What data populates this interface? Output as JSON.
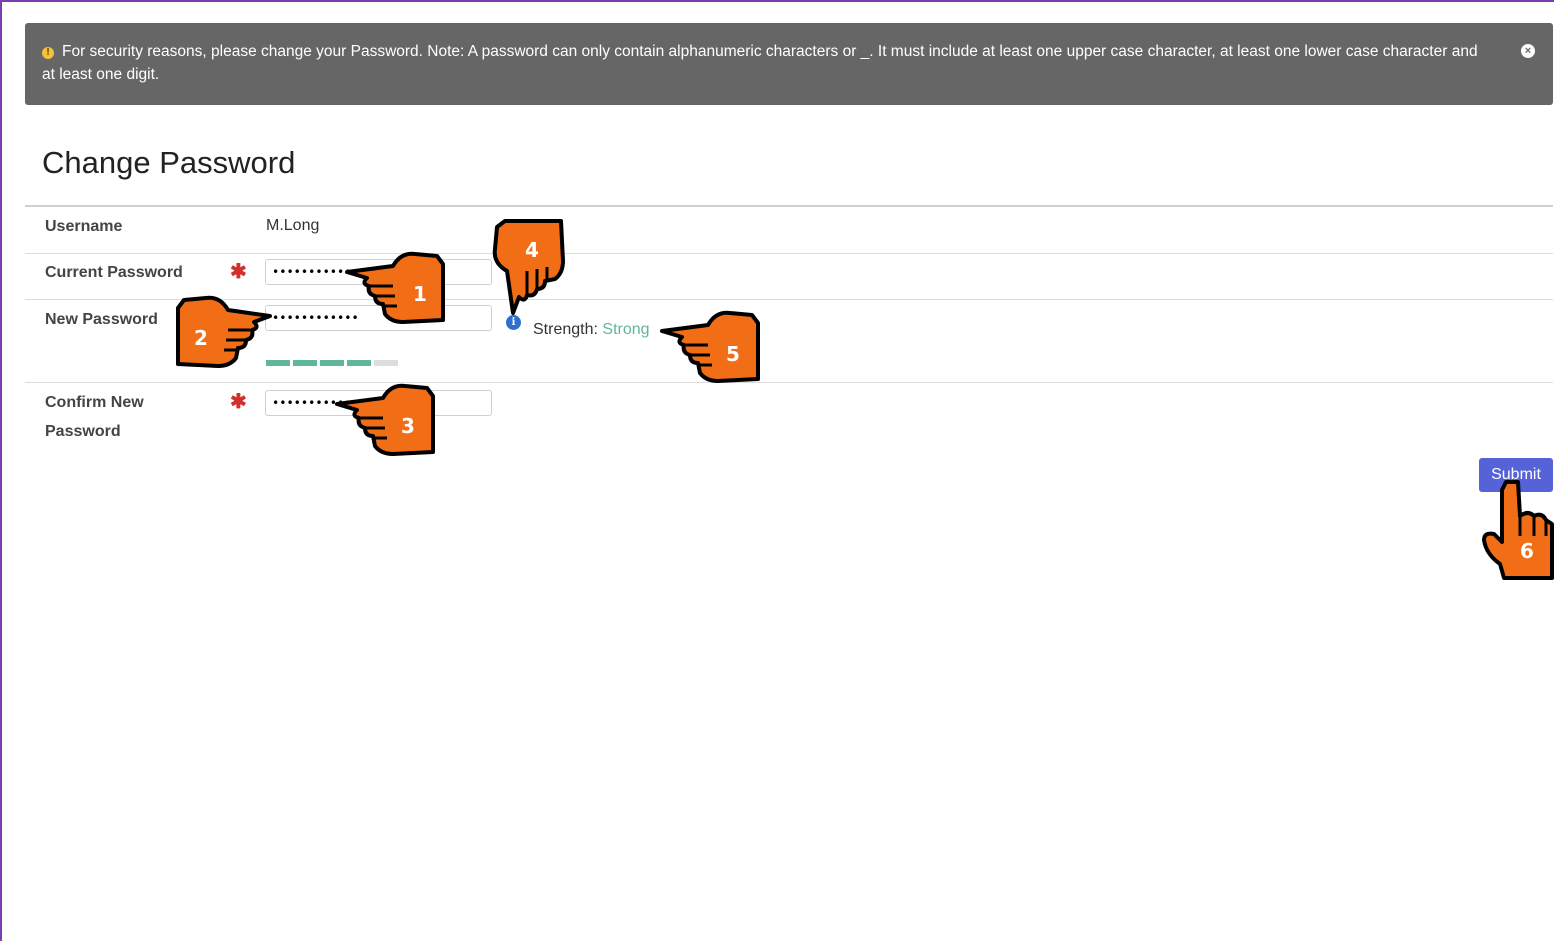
{
  "alert": {
    "icon": "warning-icon",
    "message": "For security reasons, please change your Password. Note: A password can only contain alphanumeric characters or _. It must include at least one upper case character, at least one lower case character and at least one digit.",
    "close_icon": "close-icon"
  },
  "page": {
    "title": "Change Password"
  },
  "form": {
    "username_label": "Username",
    "username_value": "M.Long",
    "current_label": "Current Password",
    "current_value": "••••••••••••",
    "new_label": "New Password",
    "new_value": "••••••••••••",
    "confirm_label_line1": "Confirm New",
    "confirm_label_line2": "Password",
    "confirm_value": "••••••••••••",
    "required_mark": "✱",
    "info_icon": "info-icon",
    "strength_label": "Strength:",
    "strength_value": "Strong",
    "strength_level": 0.8,
    "strength_color": "#5fb79a",
    "submit_label": "Submit"
  },
  "callouts": {
    "c1": "1",
    "c2": "2",
    "c3": "3",
    "c4": "4",
    "c5": "5",
    "c6": "6",
    "color": "#f26e16"
  }
}
